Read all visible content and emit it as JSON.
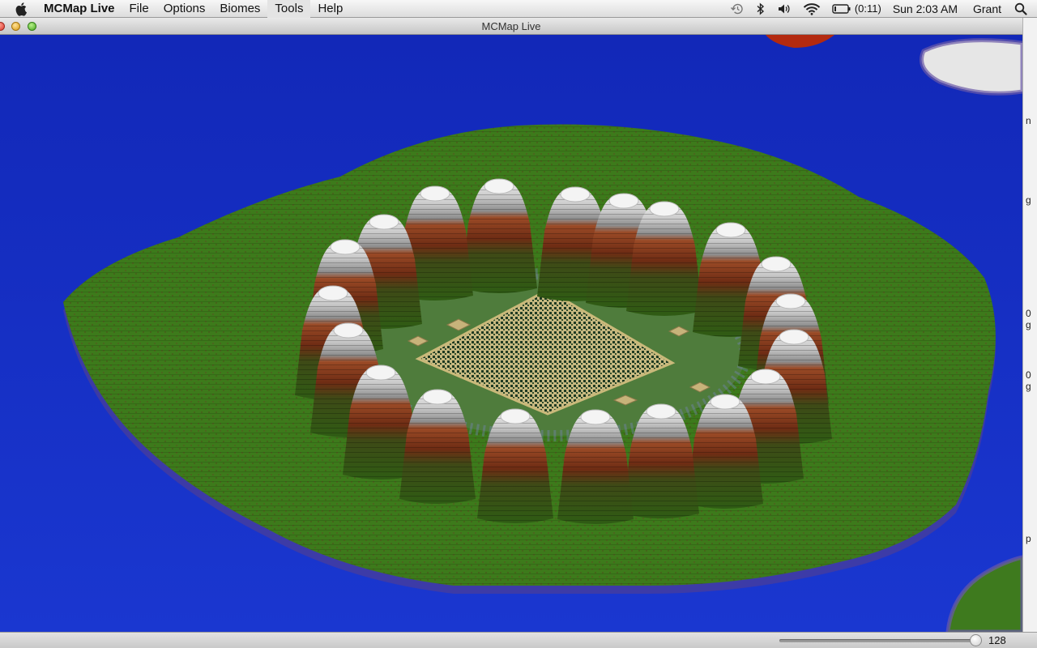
{
  "menubar": {
    "app_name": "MCMap Live",
    "items": [
      "File",
      "Options",
      "Biomes",
      "Tools",
      "Help"
    ],
    "status": {
      "battery_time": "(0:11)",
      "clock": "Sun 2:03 AM",
      "user": "Grant"
    },
    "icons": [
      "apple-icon",
      "time-machine-icon",
      "bluetooth-icon",
      "volume-icon",
      "wifi-icon",
      "battery-icon",
      "spotlight-icon"
    ]
  },
  "window": {
    "title": "MCMap Live"
  },
  "toolbar": {
    "zoom_value": "128",
    "zoom_fraction": 0.97
  },
  "edge_fragments": [
    "n",
    "g",
    "0",
    "g",
    "0",
    "g",
    "p"
  ],
  "colors": {
    "water": "#1a2dbf",
    "grass": "#3f7a1c",
    "dirt": "#8a3a1e",
    "stone": "#9a9a9a",
    "snow": "#e8e8e8",
    "sand": "#c8b878"
  }
}
